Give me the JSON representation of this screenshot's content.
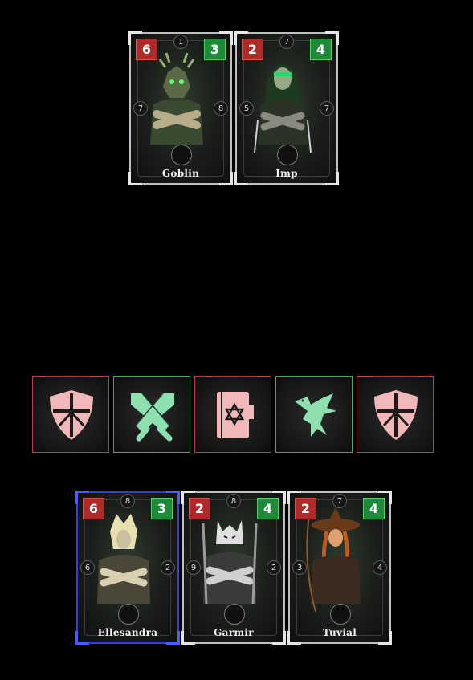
{
  "colors": {
    "attack": "#b02a2a",
    "health": "#1f8a3a",
    "selected_border": "#3040d8",
    "card_border": "#bfbfbf",
    "slot_red": "#c53a3a",
    "slot_green": "#35b060",
    "icon_pink": "#f0b8b8",
    "icon_green": "#8fe0b0"
  },
  "enemy_cards": [
    {
      "name": "Goblin",
      "attack": "6",
      "health": "3",
      "rank_top": "1",
      "rank_left": "7",
      "rank_right": "8"
    },
    {
      "name": "Imp",
      "attack": "2",
      "health": "4",
      "rank_top": "7",
      "rank_left": "5",
      "rank_right": "7"
    }
  ],
  "action_slots": [
    {
      "icon": "shield-icon",
      "tone": "red"
    },
    {
      "icon": "crossed-swords-icon",
      "tone": "green"
    },
    {
      "icon": "spellbook-icon",
      "tone": "red"
    },
    {
      "icon": "dragon-icon",
      "tone": "green"
    },
    {
      "icon": "shield-icon",
      "tone": "red"
    }
  ],
  "player_cards": [
    {
      "name": "Ellesandra",
      "attack": "6",
      "health": "3",
      "rank_top": "8",
      "rank_left": "6",
      "rank_right": "2",
      "selected": true
    },
    {
      "name": "Garmir",
      "attack": "2",
      "health": "4",
      "rank_top": "8",
      "rank_left": "9",
      "rank_right": "2"
    },
    {
      "name": "Tuvial",
      "attack": "2",
      "health": "4",
      "rank_top": "7",
      "rank_left": "3",
      "rank_right": "4"
    }
  ]
}
